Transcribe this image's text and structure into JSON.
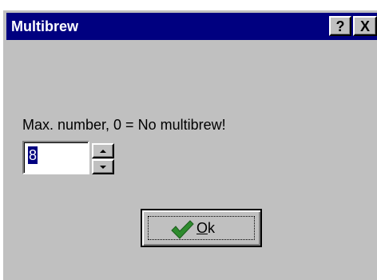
{
  "window": {
    "title": "Multibrew",
    "help_button": "?",
    "close_button": "X"
  },
  "form": {
    "prompt_label": "Max. number, 0 = No multibrew!",
    "spin_value": "8"
  },
  "ok_button": {
    "mnemonic": "O",
    "rest": "k",
    "icon": "checkmark-icon"
  },
  "colors": {
    "titlebar": "#000080",
    "face": "#c0c0c0",
    "check": "#2e8b2e"
  }
}
